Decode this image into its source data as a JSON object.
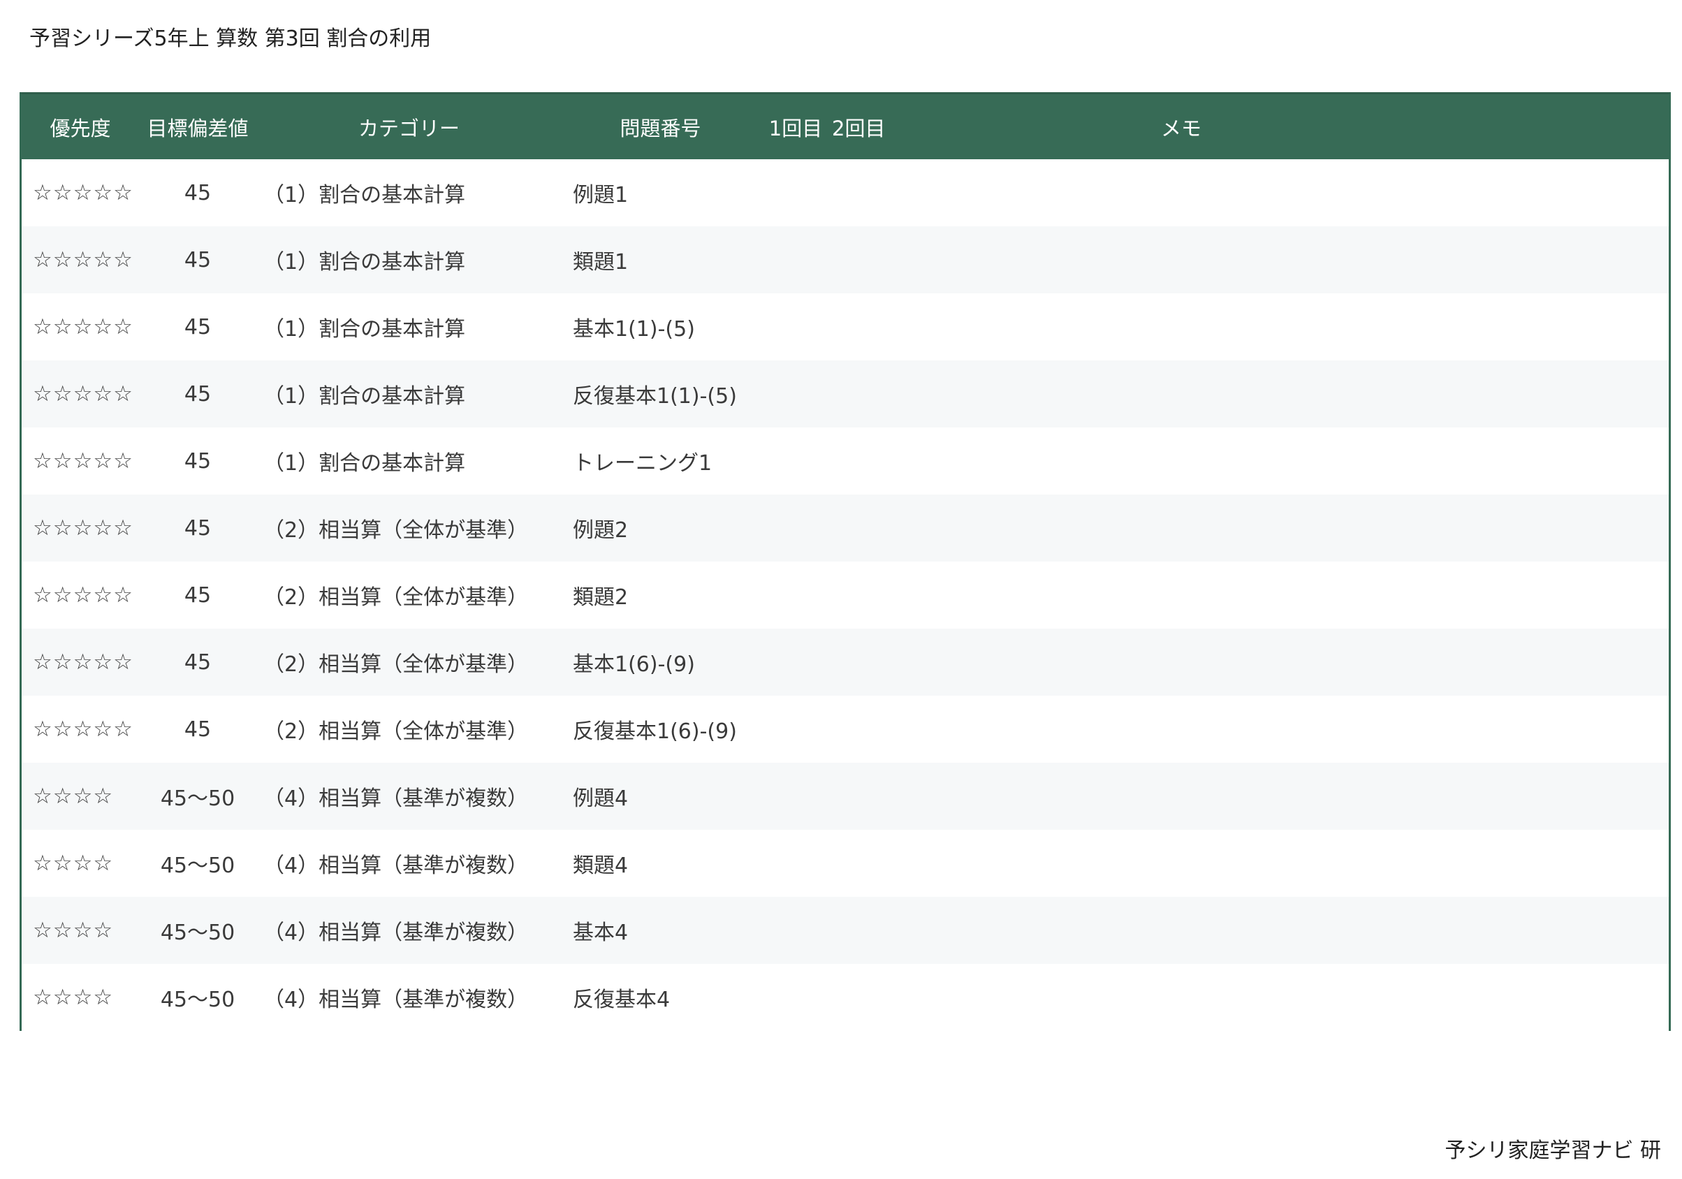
{
  "title": "予習シリーズ5年上 算数 第3回 割合の利用",
  "columns": {
    "priority": "優先度",
    "target_deviation": "目標偏差値",
    "category": "カテゴリー",
    "problem_number": "問題番号",
    "first": "1回目",
    "second": "2回目",
    "memo": "メモ"
  },
  "rows": [
    {
      "priority": "☆☆☆☆☆",
      "target_deviation": "45",
      "category": "（1）割合の基本計算",
      "problem_number": "例題1",
      "first": "",
      "second": "",
      "memo": ""
    },
    {
      "priority": "☆☆☆☆☆",
      "target_deviation": "45",
      "category": "（1）割合の基本計算",
      "problem_number": "類題1",
      "first": "",
      "second": "",
      "memo": ""
    },
    {
      "priority": "☆☆☆☆☆",
      "target_deviation": "45",
      "category": "（1）割合の基本計算",
      "problem_number": "基本1(1)-(5)",
      "first": "",
      "second": "",
      "memo": ""
    },
    {
      "priority": "☆☆☆☆☆",
      "target_deviation": "45",
      "category": "（1）割合の基本計算",
      "problem_number": "反復基本1(1)-(5)",
      "first": "",
      "second": "",
      "memo": ""
    },
    {
      "priority": "☆☆☆☆☆",
      "target_deviation": "45",
      "category": "（1）割合の基本計算",
      "problem_number": "トレーニング1",
      "first": "",
      "second": "",
      "memo": ""
    },
    {
      "priority": "☆☆☆☆☆",
      "target_deviation": "45",
      "category": "（2）相当算（全体が基準）",
      "problem_number": "例題2",
      "first": "",
      "second": "",
      "memo": ""
    },
    {
      "priority": "☆☆☆☆☆",
      "target_deviation": "45",
      "category": "（2）相当算（全体が基準）",
      "problem_number": "類題2",
      "first": "",
      "second": "",
      "memo": ""
    },
    {
      "priority": "☆☆☆☆☆",
      "target_deviation": "45",
      "category": "（2）相当算（全体が基準）",
      "problem_number": "基本1(6)-(9)",
      "first": "",
      "second": "",
      "memo": ""
    },
    {
      "priority": "☆☆☆☆☆",
      "target_deviation": "45",
      "category": "（2）相当算（全体が基準）",
      "problem_number": "反復基本1(6)-(9)",
      "first": "",
      "second": "",
      "memo": ""
    },
    {
      "priority": "☆☆☆☆",
      "target_deviation": "45〜50",
      "category": "（4）相当算（基準が複数）",
      "problem_number": "例題4",
      "first": "",
      "second": "",
      "memo": ""
    },
    {
      "priority": "☆☆☆☆",
      "target_deviation": "45〜50",
      "category": "（4）相当算（基準が複数）",
      "problem_number": "類題4",
      "first": "",
      "second": "",
      "memo": ""
    },
    {
      "priority": "☆☆☆☆",
      "target_deviation": "45〜50",
      "category": "（4）相当算（基準が複数）",
      "problem_number": "基本4",
      "first": "",
      "second": "",
      "memo": ""
    },
    {
      "priority": "☆☆☆☆",
      "target_deviation": "45〜50",
      "category": "（4）相当算（基準が複数）",
      "problem_number": "反復基本4",
      "first": "",
      "second": "",
      "memo": ""
    }
  ],
  "footer": "予シリ家庭学習ナビ 研"
}
